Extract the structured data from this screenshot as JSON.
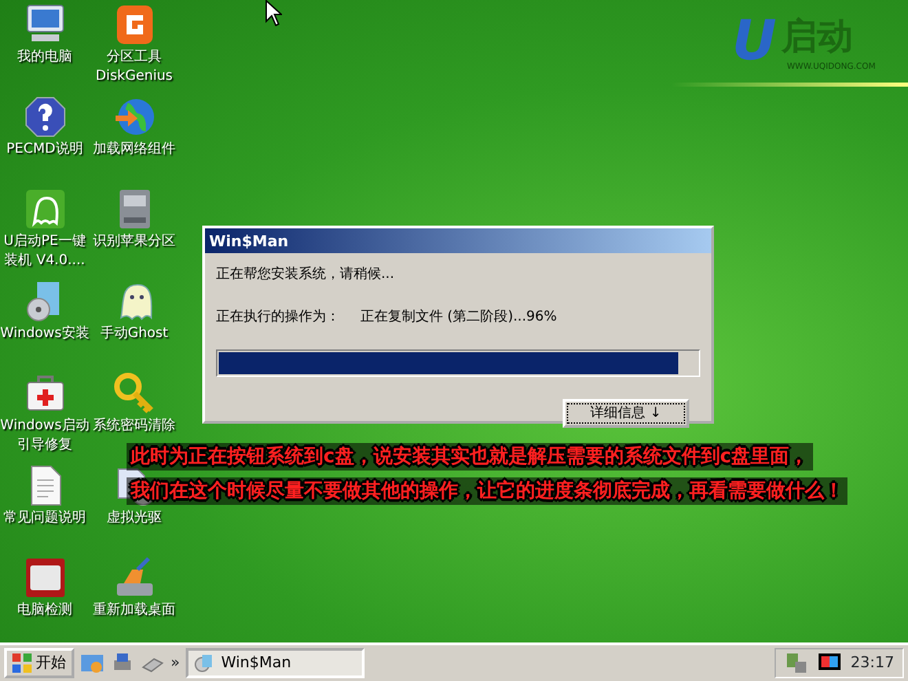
{
  "desktop_icons": [
    {
      "label": [
        "我的电脑"
      ],
      "kind": "computer"
    },
    {
      "label": [
        "分区工具",
        "DiskGenius"
      ],
      "kind": "diskgenius"
    },
    {
      "label": [
        "PECMD说明"
      ],
      "kind": "help"
    },
    {
      "label": [
        "加载网络组件"
      ],
      "kind": "globe"
    },
    {
      "label": [
        "U启动PE一键",
        "装机 V4.0...."
      ],
      "kind": "greenghost"
    },
    {
      "label": [
        "识别苹果分区"
      ],
      "kind": "drive"
    },
    {
      "label": [
        "Windows安装"
      ],
      "kind": "wincd"
    },
    {
      "label": [
        "手动Ghost"
      ],
      "kind": "ghost"
    },
    {
      "label": [
        "Windows启动",
        "引导修复"
      ],
      "kind": "firstaid"
    },
    {
      "label": [
        "系统密码清除"
      ],
      "kind": "key"
    },
    {
      "label": [
        "常见问题说明"
      ],
      "kind": "document"
    },
    {
      "label": [
        "虚拟光驱"
      ],
      "kind": "disc"
    },
    {
      "label": [
        "电脑检测"
      ],
      "kind": "sixtyfour"
    },
    {
      "label": [
        "重新加载桌面"
      ],
      "kind": "brush"
    }
  ],
  "logo": {
    "mark": "U",
    "name": "启动",
    "url": "WWW.UQIDONG.COM"
  },
  "dialog": {
    "title": "Win$Man",
    "message": "正在帮您安装系统，请稍候...",
    "operation_label": "正在执行的操作为：",
    "operation": "正在复制文件 (第二阶段)...96%",
    "progress": {
      "level": 0.96
    },
    "button": "详细信息 ↓"
  },
  "overlay_text": [
    "此时为正在按钮系统到c盘，说安装其实也就是解压需要的系统文件到c盘里面，",
    "我们在这个时候尽量不要做其他的操作，让它的进度条彻底完成，再看需要做什么！"
  ],
  "taskbar": {
    "start": "开始",
    "more": "»",
    "tasks": [
      {
        "label": "Win$Man",
        "selected": false
      }
    ],
    "clock": "23:17"
  }
}
